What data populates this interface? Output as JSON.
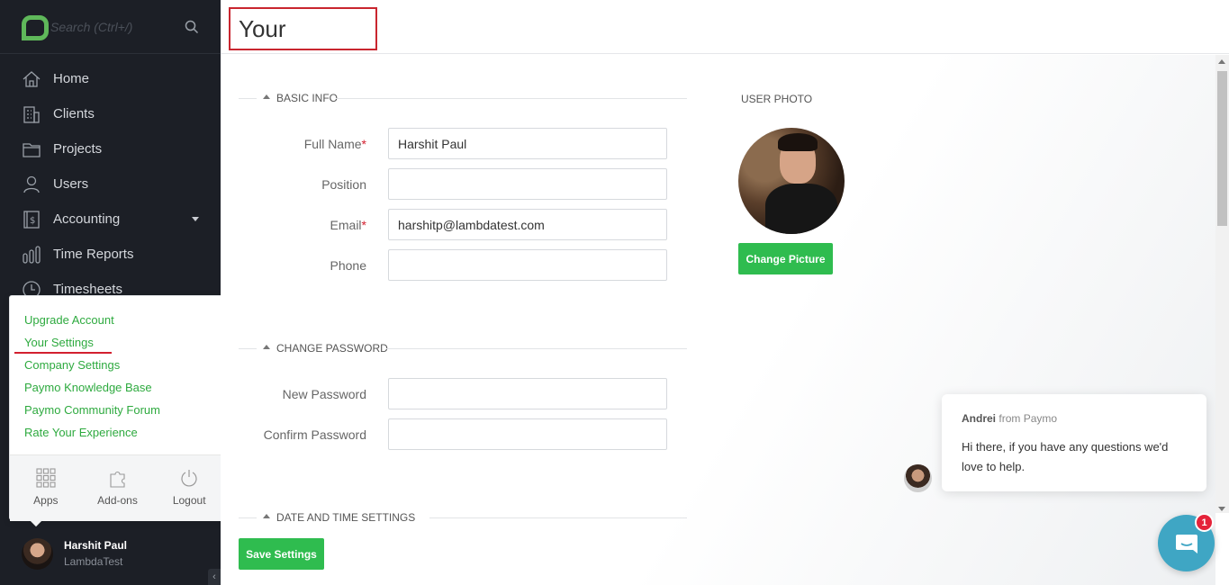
{
  "sidebar": {
    "search_placeholder": "Search (Ctrl+/)",
    "items": [
      {
        "label": "Home",
        "icon": "home-icon"
      },
      {
        "label": "Clients",
        "icon": "building-icon"
      },
      {
        "label": "Projects",
        "icon": "folder-icon"
      },
      {
        "label": "Users",
        "icon": "user-icon"
      },
      {
        "label": "Accounting",
        "icon": "ledger-icon"
      },
      {
        "label": "Time Reports",
        "icon": "bar-chart-icon"
      },
      {
        "label": "Timesheets",
        "icon": "clock-icon"
      }
    ],
    "user": {
      "name": "Harshit Paul",
      "company": "LambdaTest"
    }
  },
  "popup": {
    "links": [
      "Upgrade Account",
      "Your Settings",
      "Company Settings",
      "Paymo Knowledge Base",
      "Paymo Community Forum",
      "Rate Your Experience"
    ],
    "apps": [
      {
        "label": "Apps",
        "icon": "grid-icon"
      },
      {
        "label": "Add-ons",
        "icon": "puzzle-icon"
      },
      {
        "label": "Logout",
        "icon": "power-icon"
      }
    ]
  },
  "header": {
    "title": "Your Settings"
  },
  "basic_info": {
    "heading": "BASIC INFO",
    "full_name_label": "Full Name",
    "full_name_value": "Harshit Paul",
    "position_label": "Position",
    "position_value": "",
    "email_label": "Email",
    "email_value": "harshitp@lambdatest.com",
    "phone_label": "Phone",
    "phone_value": "",
    "required_mark": "*"
  },
  "user_photo": {
    "heading": "USER PHOTO",
    "change_button": "Change Picture"
  },
  "change_password": {
    "heading": "CHANGE PASSWORD",
    "new_label": "New Password",
    "confirm_label": "Confirm Password"
  },
  "date_time": {
    "heading": "DATE AND TIME SETTINGS"
  },
  "save_button": "Save Settings",
  "chat": {
    "agent": "Andrei",
    "from_text": "from Paymo",
    "message": "Hi there, if you have any questions we'd love to help.",
    "badge_count": "1"
  },
  "colors": {
    "accent_green": "#2fbc4f",
    "sidebar_bg": "#1c1f26",
    "highlight_red": "#d3202f",
    "chat_blue": "#3fa6c4"
  }
}
